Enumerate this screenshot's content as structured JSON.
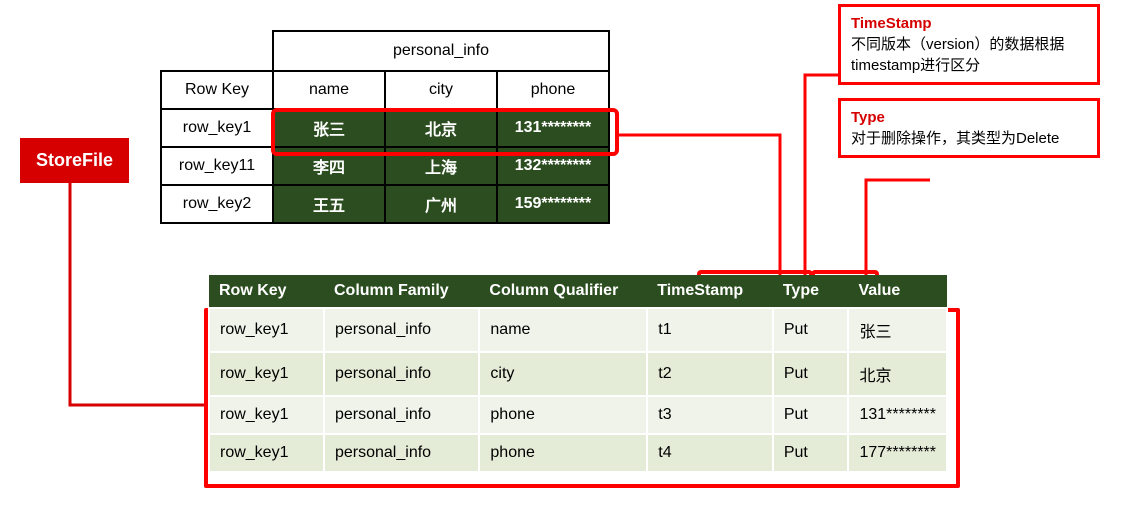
{
  "storefile_label": "StoreFile",
  "upper": {
    "cf_header": "personal_info",
    "rowkey_header": "Row Key",
    "cols": [
      "name",
      "city",
      "phone"
    ],
    "rows": [
      {
        "key": "row_key1",
        "cells": [
          "张三",
          "北京",
          "131********"
        ]
      },
      {
        "key": "row_key11",
        "cells": [
          "李四",
          "上海",
          "132********"
        ]
      },
      {
        "key": "row_key2",
        "cells": [
          "王五",
          "广州",
          "159********"
        ]
      }
    ]
  },
  "lower": {
    "headers": [
      "Row Key",
      "Column Family",
      "Column Qualifier",
      "TimeStamp",
      "Type",
      "Value"
    ],
    "rows": [
      [
        "row_key1",
        "personal_info",
        "name",
        "t1",
        "Put",
        "张三"
      ],
      [
        "row_key1",
        "personal_info",
        "city",
        "t2",
        "Put",
        "北京"
      ],
      [
        "row_key1",
        "personal_info",
        "phone",
        "t3",
        "Put",
        "131********"
      ],
      [
        "row_key1",
        "personal_info",
        "phone",
        "t4",
        "Put",
        "177********"
      ]
    ]
  },
  "anno_timestamp": {
    "title": "TimeStamp",
    "text": "不同版本（version）的数据根据timestamp进行区分"
  },
  "anno_type": {
    "title": "Type",
    "text": "对于删除操作，其类型为Delete"
  }
}
